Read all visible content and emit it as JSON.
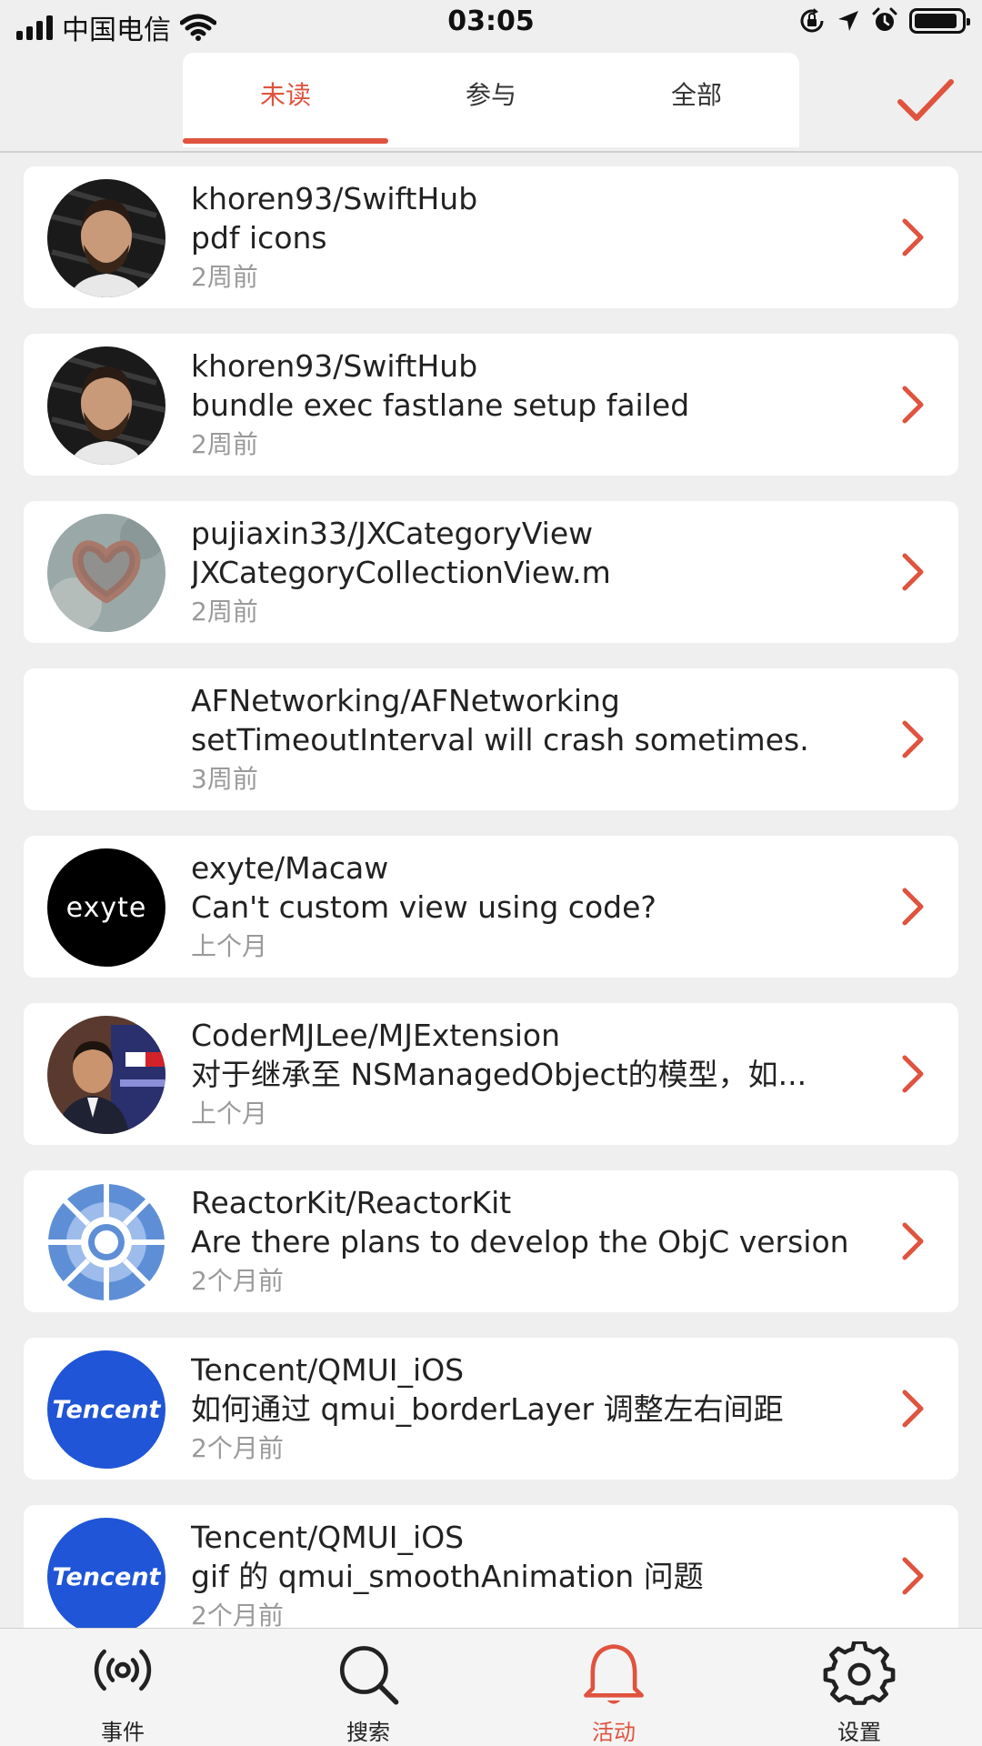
{
  "status_bar": {
    "carrier": "中国电信",
    "time": "03:05",
    "battery_level": 0.92
  },
  "tabs": [
    {
      "label": "未读",
      "active": true
    },
    {
      "label": "参与",
      "active": false
    },
    {
      "label": "全部",
      "active": false
    }
  ],
  "accent_color": "#e0533e",
  "notifications": [
    {
      "repo": "khoren93/SwiftHub",
      "title": "pdf icons",
      "time": "2周前",
      "avatar": "person-avatar"
    },
    {
      "repo": "khoren93/SwiftHub",
      "title": "bundle exec fastlane setup failed",
      "time": "2周前",
      "avatar": "person-avatar"
    },
    {
      "repo": "pujiaxin33/JXCategoryView",
      "title": "JXCategoryCollectionView.m",
      "time": "2周前",
      "avatar": "hands-heart-avatar"
    },
    {
      "repo": "AFNetworking/AFNetworking",
      "title": "setTimeoutInterval will crash sometimes.",
      "time": "3周前",
      "avatar": "blank-avatar"
    },
    {
      "repo": "exyte/Macaw",
      "title": "Can't custom view using code?",
      "time": "上个月",
      "avatar": "exyte-logo",
      "avatar_text": "exyte"
    },
    {
      "repo": "CoderMJLee/MJExtension",
      "title": "对于继承至 NSManagedObject的模型，如...",
      "time": "上个月",
      "avatar": "person-avatar"
    },
    {
      "repo": "ReactorKit/ReactorKit",
      "title": "Are there plans to develop the ObjC version",
      "time": "2个月前",
      "avatar": "reactorkit-logo"
    },
    {
      "repo": "Tencent/QMUI_iOS",
      "title": "如何通过 qmui_borderLayer 调整左右间距",
      "time": "2个月前",
      "avatar": "tencent-logo",
      "avatar_text": "Tencent"
    },
    {
      "repo": "Tencent/QMUI_iOS",
      "title": "gif 的 qmui_smoothAnimation 问题",
      "time": "2个月前",
      "avatar": "tencent-logo",
      "avatar_text": "Tencent"
    }
  ],
  "tab_bar": [
    {
      "label": "事件",
      "icon": "broadcast-icon",
      "active": false
    },
    {
      "label": "搜索",
      "icon": "search-icon",
      "active": false
    },
    {
      "label": "活动",
      "icon": "bell-icon",
      "active": true
    },
    {
      "label": "设置",
      "icon": "gear-icon",
      "active": false
    }
  ]
}
